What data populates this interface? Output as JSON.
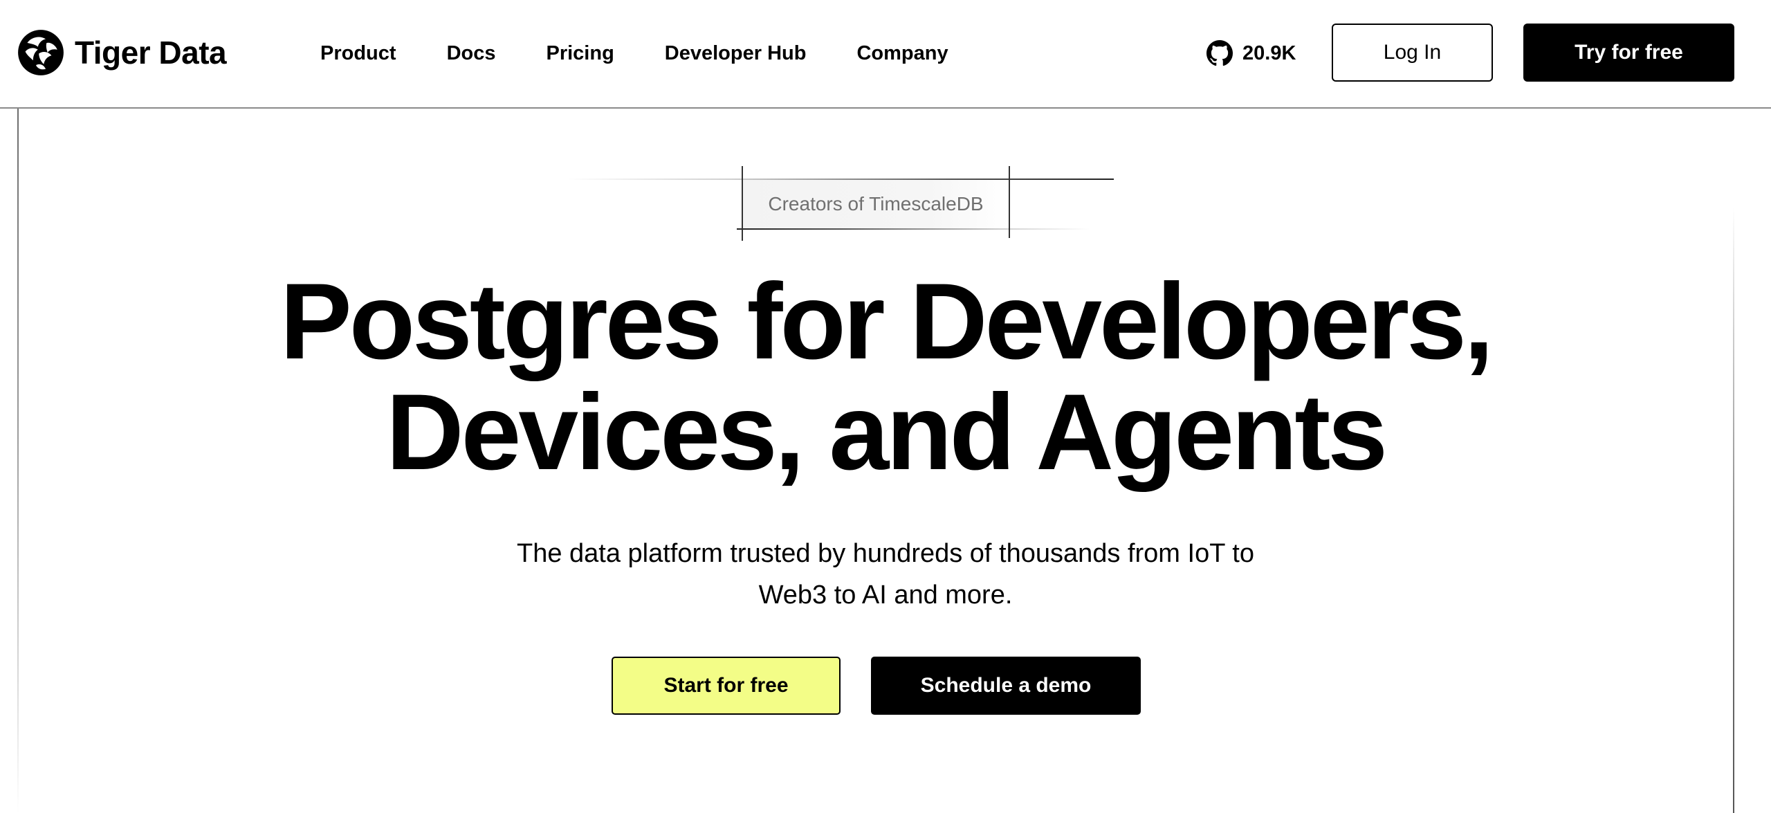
{
  "header": {
    "brand_name": "Tiger Data",
    "logo_icon": "tiger-head-logo",
    "nav": {
      "product": "Product",
      "docs": "Docs",
      "pricing": "Pricing",
      "developer_hub": "Developer Hub",
      "company": "Company"
    },
    "github": {
      "icon": "github-icon",
      "stars": "20.9K"
    },
    "login_label": "Log In",
    "try_label": "Try for free"
  },
  "hero": {
    "badge": "Creators of TimescaleDB",
    "title_line1": "Postgres for Developers,",
    "title_line2": "Devices, and Agents",
    "subtitle_line1": "The data platform trusted by hundreds of thousands from IoT to",
    "subtitle_line2": "Web3 to AI and more.",
    "cta_primary": "Start for free",
    "cta_secondary": "Schedule a demo"
  },
  "colors": {
    "accent_yellow": "#f3fd87",
    "primary_black": "#000000",
    "badge_text": "#707070"
  }
}
